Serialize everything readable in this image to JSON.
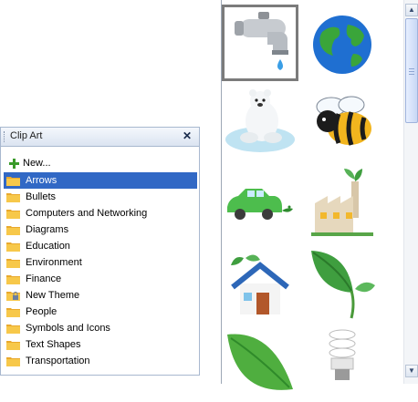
{
  "panel": {
    "title": "Clip Art",
    "close_glyph": "✕",
    "new_label": "New...",
    "folders": [
      {
        "label": "Arrows",
        "selected": true,
        "icon": "folder-icon"
      },
      {
        "label": "Bullets",
        "icon": "folder-icon"
      },
      {
        "label": "Computers and Networking",
        "icon": "folder-icon"
      },
      {
        "label": "Diagrams",
        "icon": "folder-icon"
      },
      {
        "label": "Education",
        "icon": "folder-icon"
      },
      {
        "label": "Environment",
        "icon": "folder-icon"
      },
      {
        "label": "Finance",
        "icon": "folder-icon"
      },
      {
        "label": "New Theme",
        "icon": "locked-folder-icon"
      },
      {
        "label": "People",
        "icon": "folder-icon"
      },
      {
        "label": "Symbols and Icons",
        "icon": "folder-icon"
      },
      {
        "label": "Text Shapes",
        "icon": "folder-icon"
      },
      {
        "label": "Transportation",
        "icon": "folder-icon"
      }
    ]
  },
  "gallery": {
    "items": [
      {
        "icon": "water-faucet-icon",
        "selected": true
      },
      {
        "icon": "earth-globe-icon"
      },
      {
        "icon": "polar-bear-icon"
      },
      {
        "icon": "bee-icon"
      },
      {
        "icon": "green-car-icon"
      },
      {
        "icon": "factory-sprout-icon"
      },
      {
        "icon": "green-house-icon"
      },
      {
        "icon": "leaf-sprout-icon"
      },
      {
        "icon": "leaf-icon"
      },
      {
        "icon": "cfl-bulb-icon"
      }
    ]
  },
  "scrollbar": {
    "up_glyph": "▲",
    "down_glyph": "▼",
    "position_fraction": 0.0
  },
  "colors": {
    "selection": "#3168c5",
    "panel_border": "#a8b8cf",
    "folder": "#f2b93b"
  }
}
